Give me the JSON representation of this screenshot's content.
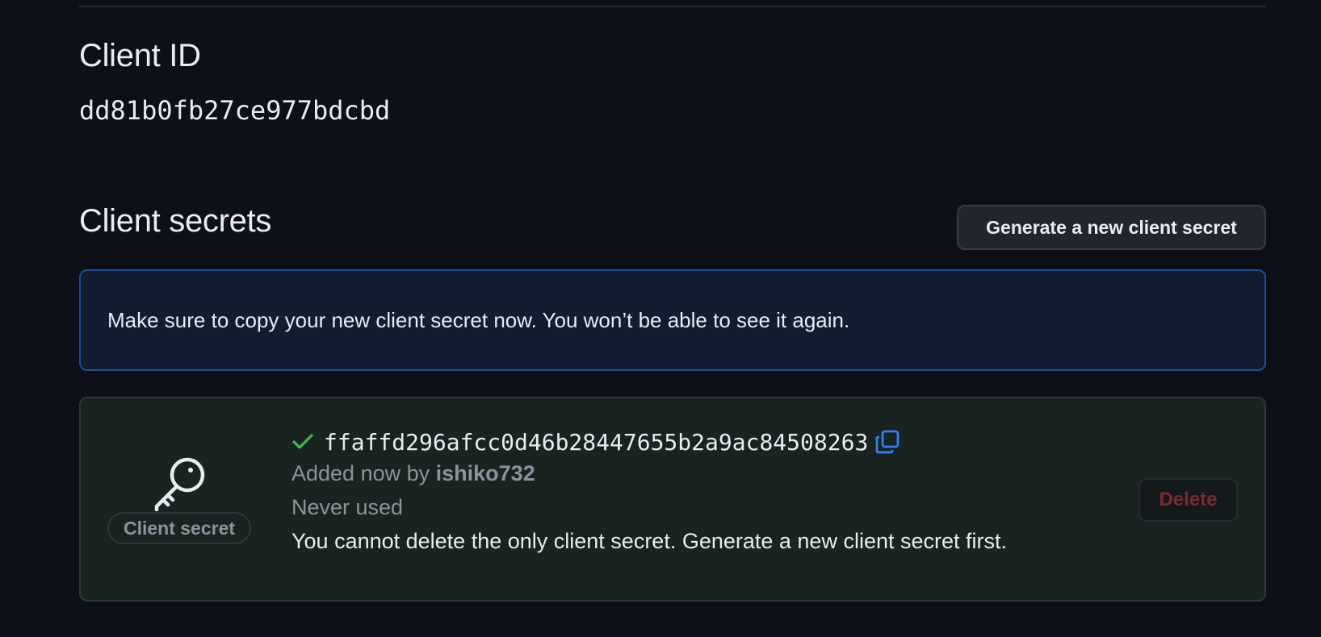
{
  "client_id": {
    "heading": "Client ID",
    "value": "dd81b0fb27ce977bdcbd"
  },
  "client_secrets": {
    "heading": "Client secrets",
    "generate_button_label": "Generate a new client secret",
    "flash_message": "Make sure to copy your new client secret now. You won’t be able to see it again.",
    "secret": {
      "type_label": "Client secret",
      "value": "ffaffd296afcc0d46b28447655b2a9ac84508263",
      "added_prefix": "Added now by",
      "added_by": "ishiko732",
      "usage": "Never used",
      "delete_notice": "You cannot delete the only client secret. Generate a new client secret first.",
      "delete_button_label": "Delete"
    }
  },
  "icons": {
    "key": "key-icon",
    "check": "check-icon",
    "copy": "copy-icon"
  },
  "colors": {
    "background": "#0d1117",
    "accent_blue": "#2f81f7",
    "success_green": "#3fb950",
    "danger_red": "#7d2a2d",
    "flash_border": "#1f4f94"
  }
}
